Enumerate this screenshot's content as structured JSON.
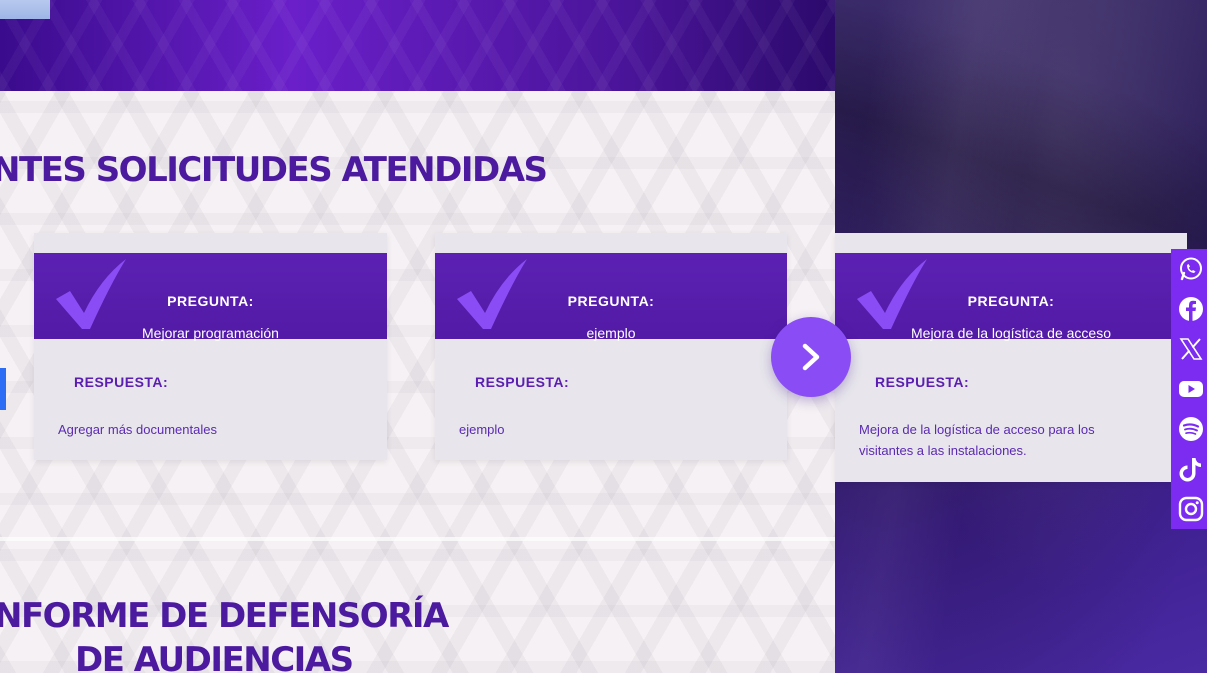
{
  "sections": {
    "attended": {
      "heading": "NTES SOLICITUDES ATENDIDAS"
    },
    "report": {
      "heading_line1": "NFORME DE DEFENSORÍA",
      "heading_line2": "DE AUDIENCIAS"
    }
  },
  "cards": [
    {
      "question_label": "PREGUNTA:",
      "question": "Mejorar programación",
      "answer_label": "RESPUESTA:",
      "answer": "Agregar más documentales"
    },
    {
      "question_label": "PREGUNTA:",
      "question": "ejemplo",
      "answer_label": "RESPUESTA:",
      "answer": "ejemplo"
    },
    {
      "question_label": "PREGUNTA:",
      "question": "Mejora de la logística de acceso",
      "answer_label": "RESPUESTA:",
      "answer": "Mejora de la logística de acceso para los visitantes a las instalaciones."
    }
  ],
  "carousel": {
    "next_icon": "chevron-right-icon"
  },
  "social": [
    "whatsapp-icon",
    "facebook-icon",
    "x-icon",
    "youtube-icon",
    "spotify-icon",
    "tiktok-icon",
    "instagram-icon"
  ],
  "colors": {
    "brand_purple": "#5a1fb0",
    "accent_violet": "#8a4df5",
    "rail_purple": "#7b2cf0",
    "prev_blue": "#2d6df6"
  }
}
